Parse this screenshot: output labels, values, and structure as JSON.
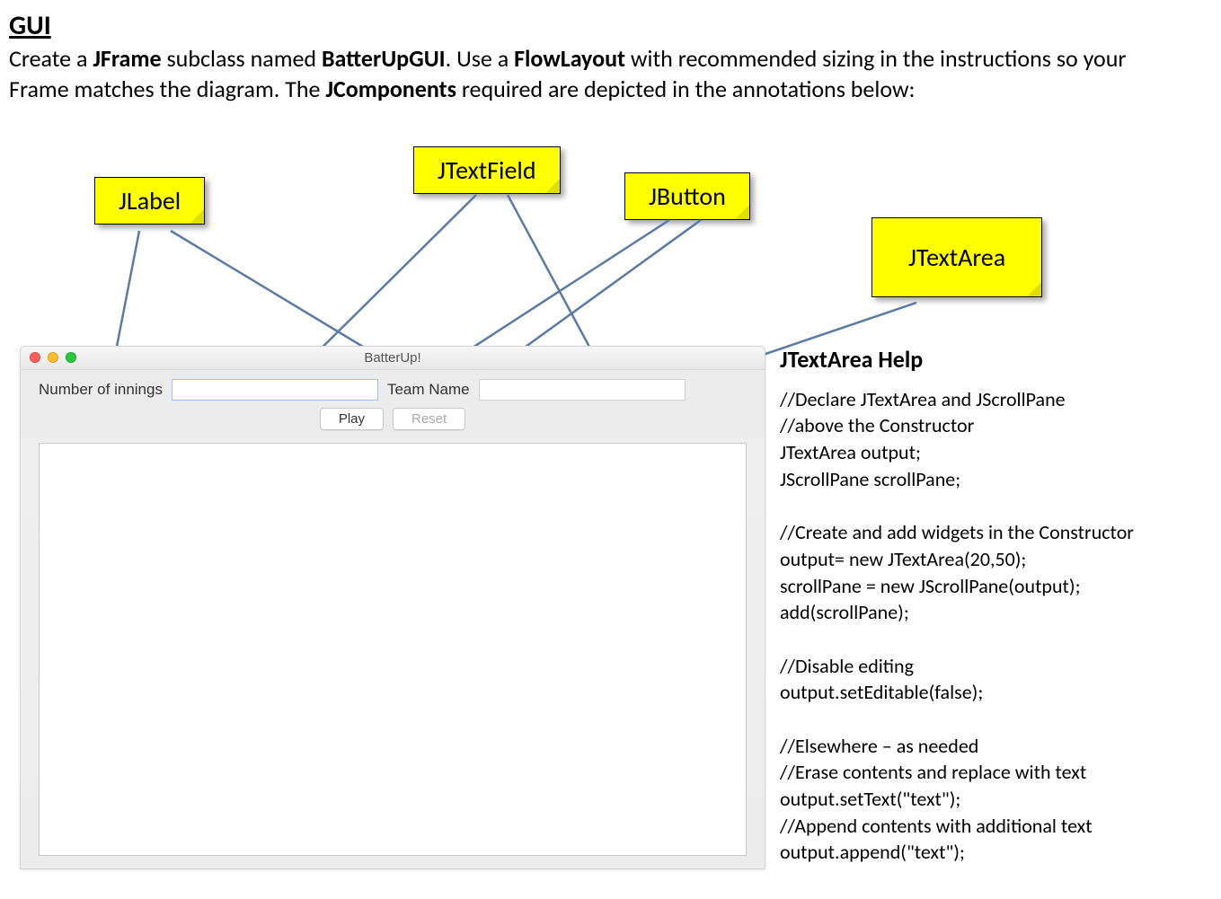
{
  "heading": "GUI",
  "intro": {
    "pre1": "Create a ",
    "b1": "JFrame",
    "mid1": " subclass named ",
    "b2": "BatterUpGUI",
    "mid2": ".  Use a ",
    "b3": "FlowLayout",
    "mid3": " with recommended sizing in the instructions so your Frame matches the diagram.  The ",
    "b4": "JComponents",
    "post": " required are depicted in the annotations below:"
  },
  "stickies": {
    "jlabel": "JLabel",
    "jtextfield": "JTextField",
    "jbutton": "JButton",
    "jtextarea": "JTextArea"
  },
  "window": {
    "title": "BatterUp!",
    "label_innings": "Number of innings",
    "label_team": "Team Name",
    "btn_play": "Play",
    "btn_reset": "Reset",
    "innings_value": "",
    "team_value": ""
  },
  "help": {
    "title": "JTextArea Help",
    "lines": [
      "//Declare JTextArea and JScrollPane",
      "//above the Constructor",
      "JTextArea output;",
      "JScrollPane scrollPane;",
      "",
      "//Create and add widgets in the Constructor",
      "output= new JTextArea(20,50);",
      "scrollPane = new JScrollPane(output);",
      "add(scrollPane);",
      "",
      "//Disable editing",
      "output.setEditable(false);",
      "",
      "//Elsewhere – as needed",
      "//Erase contents and replace with text",
      "output.setText(\"text\");",
      "//Append contents with additional text",
      "output.append(\"text\");"
    ]
  },
  "colors": {
    "sticky_bg": "#ffff00",
    "arrow": "#5b7aa4"
  }
}
